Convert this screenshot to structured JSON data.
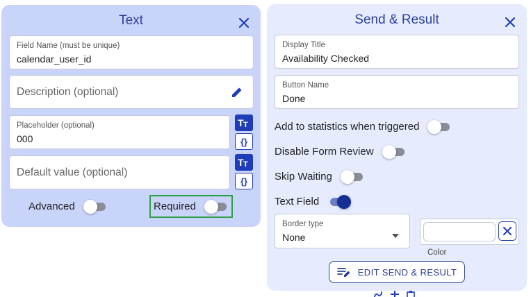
{
  "left_panel": {
    "title": "Text",
    "field_name": {
      "label": "Field Name (must be unique)",
      "value": "calendar_user_id"
    },
    "description": {
      "placeholder": "Description (optional)"
    },
    "placeholder_field": {
      "label": "Placeholder (optional)",
      "value": "000"
    },
    "default_value": {
      "placeholder": "Default value (optional)"
    },
    "text_format_btn": "Tt",
    "variable_btn": "{}",
    "advanced": {
      "label": "Advanced",
      "on": false
    },
    "required": {
      "label": "Required",
      "on": false
    }
  },
  "right_panel": {
    "title": "Send & Result",
    "display_title": {
      "label": "Display Title",
      "value": "Availability Checked"
    },
    "button_name": {
      "label": "Button Name",
      "value": "Done"
    },
    "toggles": [
      {
        "label": "Add to statistics when triggered",
        "on": false
      },
      {
        "label": "Disable Form Review",
        "on": false
      },
      {
        "label": "Skip Waiting",
        "on": false
      },
      {
        "label": "Text Field",
        "on": true
      }
    ],
    "border_type": {
      "label": "Border type",
      "value": "None"
    },
    "color": {
      "label": "Color"
    },
    "edit_button": "EDIT SEND & RESULT"
  },
  "colors": {
    "accent": "#1f3db8",
    "title": "#2b3f9b",
    "highlight": "#2ea043"
  }
}
